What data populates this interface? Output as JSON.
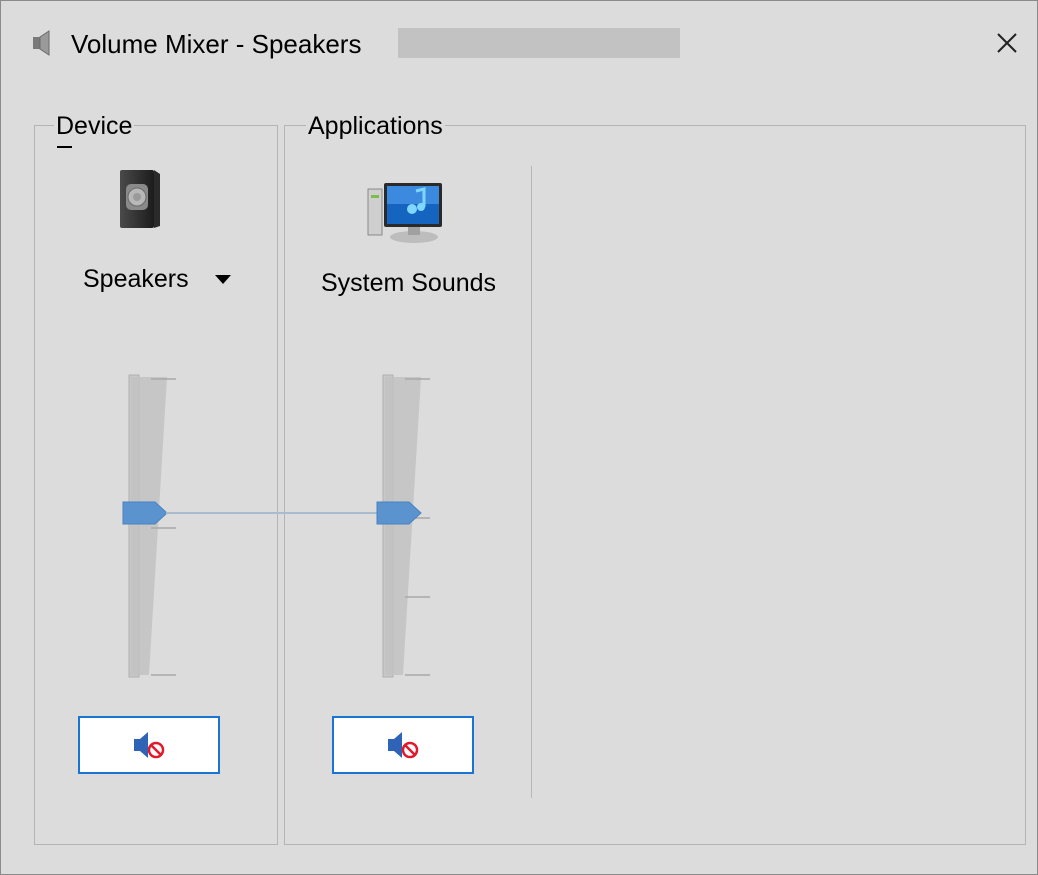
{
  "window": {
    "title": "Volume Mixer - Speakers",
    "icons": {
      "title": "speaker-volume-icon",
      "close": "close-icon"
    }
  },
  "device": {
    "group_label": "Device",
    "name": "Speakers",
    "icon": "speaker-device-icon",
    "volume_fraction": 0.45,
    "mute_icon": "muted-speaker-icon"
  },
  "applications": {
    "group_label": "Applications",
    "items": [
      {
        "name": "System Sounds",
        "icon": "system-sounds-icon",
        "volume_fraction": 0.45,
        "mute_icon": "muted-speaker-icon"
      }
    ]
  },
  "colors": {
    "background": "#dcdcdc",
    "accent": "#1b74d2",
    "slider_thumb": "#5b93cf",
    "mute_badge": "#e0192b"
  }
}
